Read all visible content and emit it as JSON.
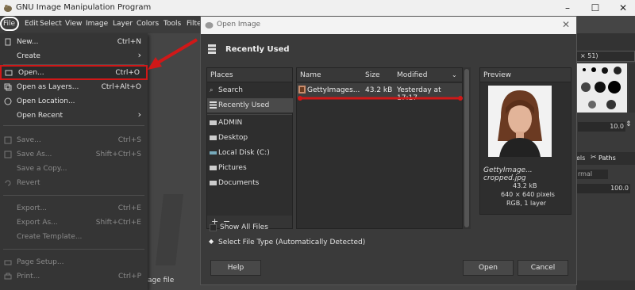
{
  "window": {
    "title": "GNU Image Manipulation Program",
    "min": "–",
    "max": "☐",
    "close": "✕"
  },
  "menubar": {
    "items": [
      "File",
      "Edit",
      "Select",
      "View",
      "Image",
      "Layer",
      "Colors",
      "Tools",
      "Filte"
    ]
  },
  "file_menu": {
    "items": [
      {
        "label": "New...",
        "accel": "Ctrl+N",
        "disabled": false
      },
      {
        "label": "Create",
        "accel": "›",
        "disabled": false
      },
      {
        "label": "Open...",
        "accel": "Ctrl+O",
        "disabled": false
      },
      {
        "label": "Open as Layers...",
        "accel": "Ctrl+Alt+O",
        "disabled": false
      },
      {
        "label": "Open Location...",
        "accel": "",
        "disabled": false
      },
      {
        "label": "Open Recent",
        "accel": "›",
        "disabled": false
      },
      {
        "label": "Save...",
        "accel": "Ctrl+S",
        "disabled": true
      },
      {
        "label": "Save As...",
        "accel": "Shift+Ctrl+S",
        "disabled": true
      },
      {
        "label": "Save a Copy...",
        "accel": "",
        "disabled": true
      },
      {
        "label": "Revert",
        "accel": "",
        "disabled": true
      },
      {
        "label": "Export...",
        "accel": "Ctrl+E",
        "disabled": true
      },
      {
        "label": "Export As...",
        "accel": "Shift+Ctrl+E",
        "disabled": true
      },
      {
        "label": "Create Template...",
        "accel": "",
        "disabled": true
      },
      {
        "label": "Page Setup...",
        "accel": "",
        "disabled": true
      },
      {
        "label": "Print...",
        "accel": "Ctrl+P",
        "disabled": true
      }
    ]
  },
  "canvas": {
    "hint": "age file"
  },
  "right_panel": {
    "brush_size": "× 51)",
    "spacing": "10.0",
    "tab_paths": "Paths",
    "tab_channels": "els",
    "mode": "rmal",
    "opacity": "100.0"
  },
  "dialog": {
    "title": "Open Image",
    "location": "Recently Used",
    "places_header": "Places",
    "places": [
      "Search",
      "Recently Used",
      "ADMIN",
      "Desktop",
      "Local Disk (C:)",
      "Pictures",
      "Documents"
    ],
    "add_remove": [
      "+",
      "−"
    ],
    "columns": {
      "name": "Name",
      "size": "Size",
      "modified": "Modified"
    },
    "files": [
      {
        "name": "GettyImages...",
        "size": "43.2 kB",
        "modified": "Yesterday at 17:17"
      }
    ],
    "preview": {
      "header": "Preview",
      "filename": "GettyImage... cropped.jpg",
      "size": "43.2 kB",
      "dims": "640 × 640 pixels",
      "mode": "RGB, 1 layer"
    },
    "show_all_files": "Show All Files",
    "select_type": "Select File Type (Automatically Detected)",
    "help": "Help",
    "open": "Open",
    "cancel": "Cancel"
  },
  "colors": {
    "highlight": "#d01818",
    "accent": "#e8e8e8"
  }
}
